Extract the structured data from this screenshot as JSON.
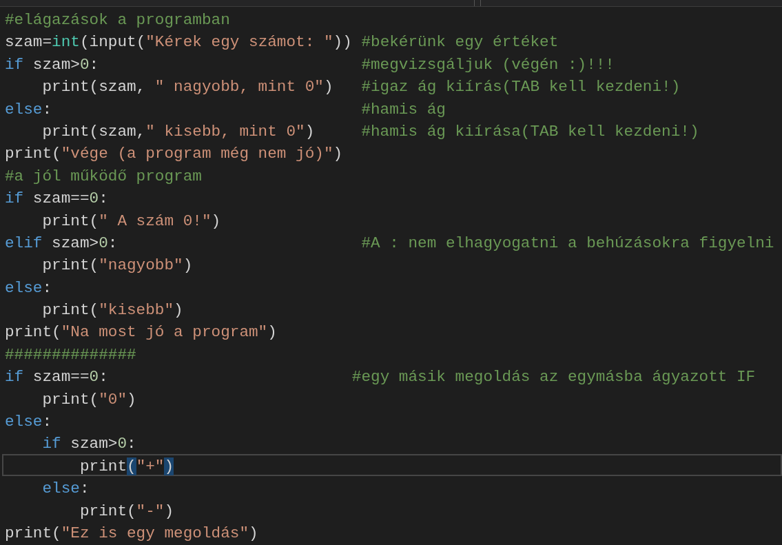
{
  "editor": {
    "lines": [
      {
        "selected": false,
        "tokens": [
          {
            "kind": "comment",
            "text": "#elágazások a programban"
          }
        ]
      },
      {
        "selected": false,
        "tokens": [
          {
            "kind": "plain",
            "text": "szam="
          },
          {
            "kind": "type",
            "text": "int"
          },
          {
            "kind": "plain",
            "text": "(input("
          },
          {
            "kind": "string",
            "text": "\"Kérek egy számot: \""
          },
          {
            "kind": "plain",
            "text": ")) "
          },
          {
            "kind": "comment",
            "text": "#bekérünk egy értéket"
          }
        ]
      },
      {
        "selected": false,
        "tokens": [
          {
            "kind": "keyword",
            "text": "if"
          },
          {
            "kind": "plain",
            "text": " szam>"
          },
          {
            "kind": "number",
            "text": "0"
          },
          {
            "kind": "plain",
            "text": ":                            "
          },
          {
            "kind": "comment",
            "text": "#megvizsgáljuk (végén :)!!!"
          }
        ]
      },
      {
        "selected": false,
        "tokens": [
          {
            "kind": "plain",
            "text": "    print(szam, "
          },
          {
            "kind": "string",
            "text": "\" nagyobb, mint 0\""
          },
          {
            "kind": "plain",
            "text": ")   "
          },
          {
            "kind": "comment",
            "text": "#igaz ág kiírás(TAB kell kezdeni!)"
          }
        ]
      },
      {
        "selected": false,
        "tokens": [
          {
            "kind": "keyword",
            "text": "else"
          },
          {
            "kind": "plain",
            "text": ":                                 "
          },
          {
            "kind": "comment",
            "text": "#hamis ág"
          }
        ]
      },
      {
        "selected": false,
        "tokens": [
          {
            "kind": "plain",
            "text": "    print(szam,"
          },
          {
            "kind": "string",
            "text": "\" kisebb, mint 0\""
          },
          {
            "kind": "plain",
            "text": ")     "
          },
          {
            "kind": "comment",
            "text": "#hamis ág kiírása(TAB kell kezdeni!)"
          }
        ]
      },
      {
        "selected": false,
        "tokens": [
          {
            "kind": "plain",
            "text": "print("
          },
          {
            "kind": "string",
            "text": "\"vége (a program még nem jó)\""
          },
          {
            "kind": "plain",
            "text": ")"
          }
        ]
      },
      {
        "selected": false,
        "tokens": [
          {
            "kind": "comment",
            "text": "#a jól működő program"
          }
        ]
      },
      {
        "selected": false,
        "tokens": [
          {
            "kind": "keyword",
            "text": "if"
          },
          {
            "kind": "plain",
            "text": " szam=="
          },
          {
            "kind": "number",
            "text": "0"
          },
          {
            "kind": "plain",
            "text": ":"
          }
        ]
      },
      {
        "selected": false,
        "tokens": [
          {
            "kind": "plain",
            "text": "    print("
          },
          {
            "kind": "string",
            "text": "\" A szám 0!\""
          },
          {
            "kind": "plain",
            "text": ")"
          }
        ]
      },
      {
        "selected": false,
        "tokens": [
          {
            "kind": "keyword",
            "text": "elif"
          },
          {
            "kind": "plain",
            "text": " szam>"
          },
          {
            "kind": "number",
            "text": "0"
          },
          {
            "kind": "plain",
            "text": ":                          "
          },
          {
            "kind": "comment",
            "text": "#A : nem elhagyogatni a behúzásokra figyelni"
          }
        ]
      },
      {
        "selected": false,
        "tokens": [
          {
            "kind": "plain",
            "text": "    print("
          },
          {
            "kind": "string",
            "text": "\"nagyobb\""
          },
          {
            "kind": "plain",
            "text": ")"
          }
        ]
      },
      {
        "selected": false,
        "tokens": [
          {
            "kind": "keyword",
            "text": "else"
          },
          {
            "kind": "plain",
            "text": ":"
          }
        ]
      },
      {
        "selected": false,
        "tokens": [
          {
            "kind": "plain",
            "text": "    print("
          },
          {
            "kind": "string",
            "text": "\"kisebb\""
          },
          {
            "kind": "plain",
            "text": ")"
          }
        ]
      },
      {
        "selected": false,
        "tokens": [
          {
            "kind": "plain",
            "text": "print("
          },
          {
            "kind": "string",
            "text": "\"Na most jó a program\""
          },
          {
            "kind": "plain",
            "text": ")"
          }
        ]
      },
      {
        "selected": false,
        "tokens": [
          {
            "kind": "comment",
            "text": "##############"
          }
        ]
      },
      {
        "selected": false,
        "tokens": [
          {
            "kind": "keyword",
            "text": "if"
          },
          {
            "kind": "plain",
            "text": " szam=="
          },
          {
            "kind": "number",
            "text": "0"
          },
          {
            "kind": "plain",
            "text": ":                          "
          },
          {
            "kind": "comment",
            "text": "#egy másik megoldás az egymásba ágyazott IF"
          }
        ]
      },
      {
        "selected": false,
        "tokens": [
          {
            "kind": "plain",
            "text": "    print("
          },
          {
            "kind": "string",
            "text": "\"0\""
          },
          {
            "kind": "plain",
            "text": ")"
          }
        ]
      },
      {
        "selected": false,
        "tokens": [
          {
            "kind": "keyword",
            "text": "else"
          },
          {
            "kind": "plain",
            "text": ":"
          }
        ]
      },
      {
        "selected": false,
        "tokens": [
          {
            "kind": "keyword",
            "text": "    if"
          },
          {
            "kind": "plain",
            "text": " szam>"
          },
          {
            "kind": "number",
            "text": "0"
          },
          {
            "kind": "plain",
            "text": ":"
          }
        ]
      },
      {
        "selected": true,
        "tokens": [
          {
            "kind": "plain",
            "text": "        print"
          },
          {
            "kind": "bracket-match",
            "text": "("
          },
          {
            "kind": "string",
            "text": "\"+\""
          },
          {
            "kind": "bracket-match",
            "text": ")"
          }
        ]
      },
      {
        "selected": false,
        "tokens": [
          {
            "kind": "keyword",
            "text": "    else"
          },
          {
            "kind": "plain",
            "text": ":"
          }
        ]
      },
      {
        "selected": false,
        "tokens": [
          {
            "kind": "plain",
            "text": "        print("
          },
          {
            "kind": "string",
            "text": "\"-\""
          },
          {
            "kind": "plain",
            "text": ")"
          }
        ]
      },
      {
        "selected": false,
        "tokens": [
          {
            "kind": "plain",
            "text": "print("
          },
          {
            "kind": "string",
            "text": "\"Ez is egy megoldás\""
          },
          {
            "kind": "plain",
            "text": ")"
          }
        ]
      }
    ]
  }
}
